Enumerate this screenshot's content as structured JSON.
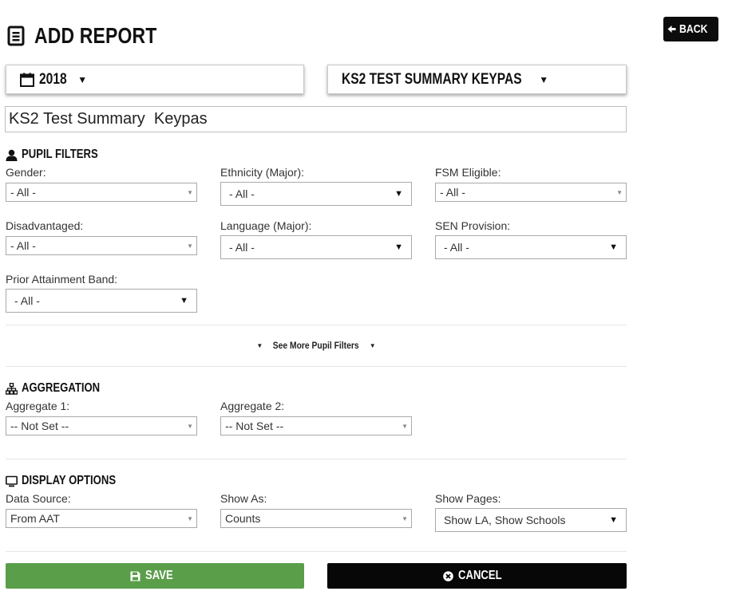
{
  "header": {
    "title": "ADD REPORT",
    "back_label": "BACK"
  },
  "pickers": {
    "year": "2018",
    "report": "KS2 TEST SUMMARY KEYPAS"
  },
  "report_name": {
    "value": "KS2 Test Summary  Keypas"
  },
  "pupil_filters": {
    "heading": "PUPIL FILTERS",
    "gender": {
      "label": "Gender:",
      "value": "- All -"
    },
    "ethnicity": {
      "label": "Ethnicity (Major):",
      "value": "- All -"
    },
    "fsm": {
      "label": "FSM Eligible:",
      "value": "- All -"
    },
    "disadvantaged": {
      "label": "Disadvantaged:",
      "value": "- All -"
    },
    "language": {
      "label": "Language (Major):",
      "value": "- All -"
    },
    "sen": {
      "label": "SEN Provision:",
      "value": "- All -"
    },
    "prior": {
      "label": "Prior Attainment Band:",
      "value": "- All -"
    },
    "see_more": "See More Pupil Filters"
  },
  "aggregation": {
    "heading": "AGGREGATION",
    "agg1": {
      "label": "Aggregate 1:",
      "value": "-- Not Set --"
    },
    "agg2": {
      "label": "Aggregate 2:",
      "value": "-- Not Set --"
    }
  },
  "display_options": {
    "heading": "DISPLAY OPTIONS",
    "data_source": {
      "label": "Data Source:",
      "value": "From AAT"
    },
    "show_as": {
      "label": "Show As:",
      "value": "Counts"
    },
    "show_pages": {
      "label": "Show Pages:",
      "value": "Show LA, Show Schools"
    }
  },
  "actions": {
    "save_label": "SAVE",
    "cancel_label": "CANCEL"
  },
  "icons": {
    "title": "document-icon",
    "back": "arrow-left-icon",
    "year": "calendar-icon",
    "pupil": "user-icon",
    "aggregation": "sitemap-icon",
    "display": "monitor-icon",
    "save": "floppy-disk-icon",
    "cancel": "times-circle-icon"
  },
  "colors": {
    "save": "#5a9e4a",
    "cancel": "#070707",
    "back": "#0c0c0c"
  }
}
